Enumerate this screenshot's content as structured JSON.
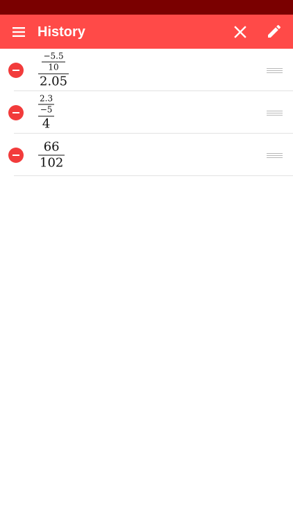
{
  "app_bar": {
    "title": "History",
    "menu_icon": "hamburger-menu-icon",
    "close_icon": "close-icon",
    "edit_icon": "pencil-icon",
    "background": "#ff4a48"
  },
  "status_bar": {
    "background": "#7a0000"
  },
  "history": [
    {
      "numerator": {
        "numerator": "−5.5",
        "denominator": "10"
      },
      "denominator": "2.05"
    },
    {
      "numerator": {
        "numerator": "2.3",
        "denominator": "−5"
      },
      "denominator": "4"
    },
    {
      "numerator": "66",
      "denominator": "102"
    }
  ],
  "colors": {
    "delete": "#f23b3b",
    "divider": "#e2e2e2",
    "handle": "#b7b7b7"
  }
}
